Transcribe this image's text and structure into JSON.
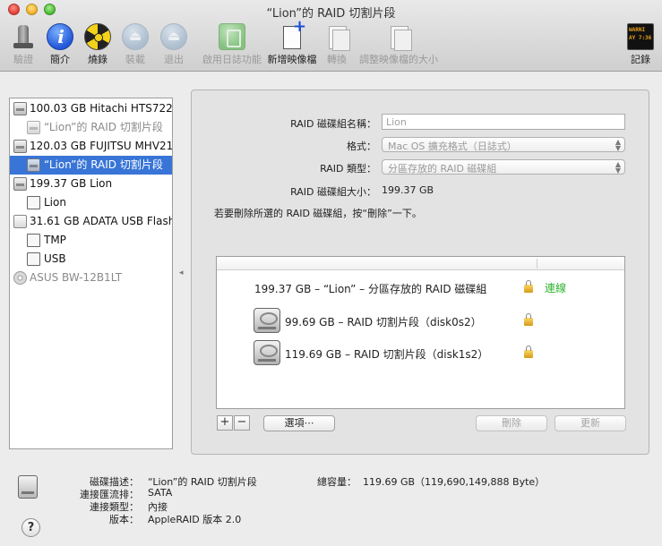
{
  "window": {
    "title": "“Lion”的 RAID 切割片段"
  },
  "toolbar": {
    "verify": "驗證",
    "info": "簡介",
    "burn": "燒錄",
    "mount": "裝載",
    "eject": "退出",
    "enable_journaling": "啟用日誌功能",
    "new_image": "新增映像檔",
    "convert": "轉換",
    "resize_image": "調整映像檔的大小",
    "log": "記錄",
    "log_icon_text": "WARNI\nAY 7:36"
  },
  "sidebar": {
    "items": [
      {
        "label": "100.03 GB Hitachi HTS722...",
        "kind": "disk"
      },
      {
        "label": "“Lion”的 RAID 切割片段",
        "kind": "slice"
      },
      {
        "label": "120.03 GB FUJITSU MHV21...",
        "kind": "disk"
      },
      {
        "label": "“Lion”的 RAID 切割片段",
        "kind": "slice",
        "selected": true
      },
      {
        "label": "199.37 GB Lion",
        "kind": "raid"
      },
      {
        "label": "Lion",
        "kind": "volume"
      },
      {
        "label": "31.61 GB ADATA USB Flash...",
        "kind": "usb"
      },
      {
        "label": "TMP",
        "kind": "volume"
      },
      {
        "label": "USB",
        "kind": "volume"
      },
      {
        "label": "ASUS BW-12B1LT",
        "kind": "optical"
      }
    ]
  },
  "raid_form": {
    "name_label": "RAID 磁碟組名稱：",
    "name_value": "Lion",
    "format_label": "格式：",
    "format_value": "Mac OS 擴充格式（日誌式）",
    "type_label": "RAID 類型：",
    "type_value": "分區存放的 RAID 磁碟組",
    "size_label": "RAID 磁碟組大小：",
    "size_value": "199.37 GB",
    "hint": "若要刪除所選的 RAID 磁碟組，按“刪除”一下。"
  },
  "raid_list": {
    "rows": [
      {
        "label": "199.37 GB – “Lion” – 分區存放的 RAID 磁碟組",
        "status": "連線"
      },
      {
        "label": "99.69 GB – RAID 切割片段（disk0s2）"
      },
      {
        "label": "119.69 GB – RAID 切割片段（disk1s2）"
      }
    ]
  },
  "buttons": {
    "add": "+",
    "remove": "−",
    "options": "選項⋯",
    "delete": "刪除",
    "update": "更新"
  },
  "info": {
    "desc_key": "磁碟描述：",
    "desc_val": "“Lion”的 RAID 切割片段",
    "bus_key": "連接匯流排：",
    "bus_val": "SATA",
    "conn_key": "連接類型：",
    "conn_val": "內接",
    "ver_key": "版本：",
    "ver_val": "AppleRAID 版本 2.0",
    "cap_key": "總容量：",
    "cap_val": "119.69 GB（119,690,149,888 Byte）"
  },
  "help": "?",
  "colors": {
    "selection": "#3875d7",
    "online": "#2db32d"
  }
}
